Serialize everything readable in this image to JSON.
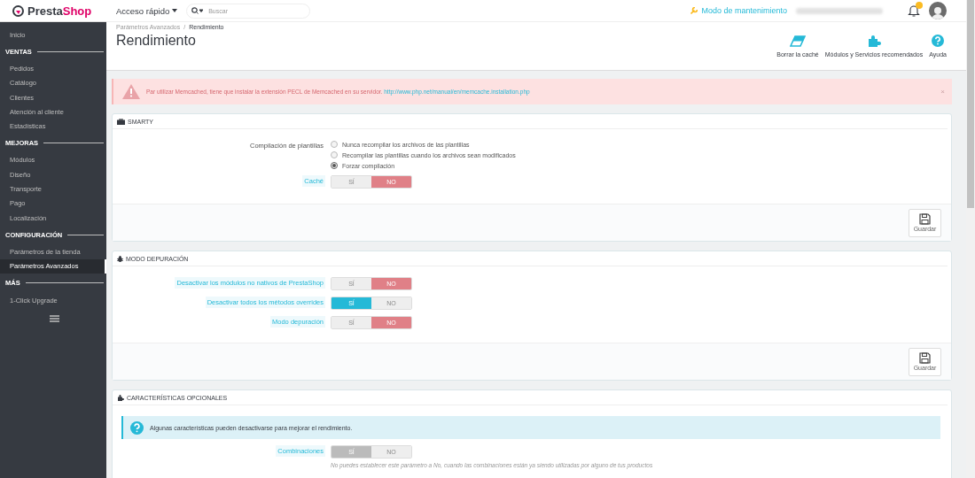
{
  "logo": {
    "first": "Presta",
    "second": "Shop"
  },
  "topbar": {
    "quick_access": "Acceso rápido",
    "search_placeholder": "Buscar",
    "maintenance": "Modo de mantenimiento",
    "notifications": {
      "unread": true
    }
  },
  "sidebar": {
    "items": [
      {
        "kind": "link",
        "label": "Inicio",
        "selected": false
      },
      {
        "kind": "section",
        "label": "VENTAS"
      },
      {
        "kind": "link",
        "label": "Pedidos",
        "selected": false
      },
      {
        "kind": "link",
        "label": "Catálogo",
        "selected": false
      },
      {
        "kind": "link",
        "label": "Clientes",
        "selected": false
      },
      {
        "kind": "link",
        "label": "Atención al cliente",
        "selected": false
      },
      {
        "kind": "link",
        "label": "Estadísticas",
        "selected": false
      },
      {
        "kind": "section",
        "label": "MEJORAS"
      },
      {
        "kind": "link",
        "label": "Módulos",
        "selected": false
      },
      {
        "kind": "link",
        "label": "Diseño",
        "selected": false
      },
      {
        "kind": "link",
        "label": "Transporte",
        "selected": false
      },
      {
        "kind": "link",
        "label": "Pago",
        "selected": false
      },
      {
        "kind": "link",
        "label": "Localización",
        "selected": false
      },
      {
        "kind": "section",
        "label": "CONFIGURACIÓN"
      },
      {
        "kind": "link",
        "label": "Parámetros de la tienda",
        "selected": false
      },
      {
        "kind": "link",
        "label": "Parámetros Avanzados",
        "selected": true
      },
      {
        "kind": "section",
        "label": "MÁS"
      },
      {
        "kind": "link",
        "label": "1-Click Upgrade",
        "selected": false
      }
    ]
  },
  "header": {
    "breadcrumb": [
      "Parámetros Avanzados",
      "Rendimiento"
    ],
    "breadcrumb_separator": "/",
    "title": "Rendimiento",
    "toolbar": [
      {
        "kind": "eraser",
        "label": "Borrar la caché"
      },
      {
        "kind": "puzzle",
        "label": "Módulos y Servicios recomendados"
      },
      {
        "kind": "help",
        "label": "Ayuda"
      }
    ]
  },
  "alert": {
    "text": "Par utilizar Memcached, tiene que instalar la extensión PECL de Memcached en su servidor.",
    "link": "http://www.php.net/manual/en/memcache.installation.php",
    "close": "×"
  },
  "panels": [
    {
      "kind": "briefcase",
      "title": "SMARTY",
      "save": "Guardar",
      "rows": [
        {
          "kind": "radio",
          "label": "Compilación de plantillas",
          "options": [
            {
              "label": "Nunca recompilar los archivos de las plantillas",
              "selected": false
            },
            {
              "label": "Recompilar las plantillas cuando los archivos sean modificados",
              "selected": false
            },
            {
              "label": "Forzar compilación",
              "selected": true
            }
          ]
        },
        {
          "kind": "switch",
          "label": "Caché",
          "yes": "SÍ",
          "no": "NO",
          "on": false,
          "disabled": false
        }
      ]
    },
    {
      "kind": "bug",
      "title": "MODO DEPURACIÓN",
      "save": "Guardar",
      "rows": [
        {
          "kind": "switch",
          "label": "Desactivar los módulos no nativos de PrestaShop",
          "yes": "SÍ",
          "no": "NO",
          "on": false,
          "disabled": false
        },
        {
          "kind": "switch",
          "label": "Desactivar todos los métodos overrides",
          "yes": "SÍ",
          "no": "NO",
          "on": true,
          "disabled": false
        },
        {
          "kind": "switch",
          "label": "Modo depuración",
          "yes": "SÍ",
          "no": "NO",
          "on": false,
          "disabled": false
        }
      ]
    },
    {
      "kind": "puzzle",
      "title": "CARACTERÍSTICAS OPCIONALES",
      "rows": [
        {
          "kind": "info",
          "text": "Algunas características pueden desactivarse para mejorar el rendimiento."
        },
        {
          "kind": "switch",
          "label": "Combinaciones",
          "yes": "SÍ",
          "no": "NO",
          "on": true,
          "disabled": true,
          "hint": "No puedes establecer este parámetro a No, cuando las combinaciones están ya siendo utilizadas por alguno de tus productos"
        }
      ]
    }
  ]
}
